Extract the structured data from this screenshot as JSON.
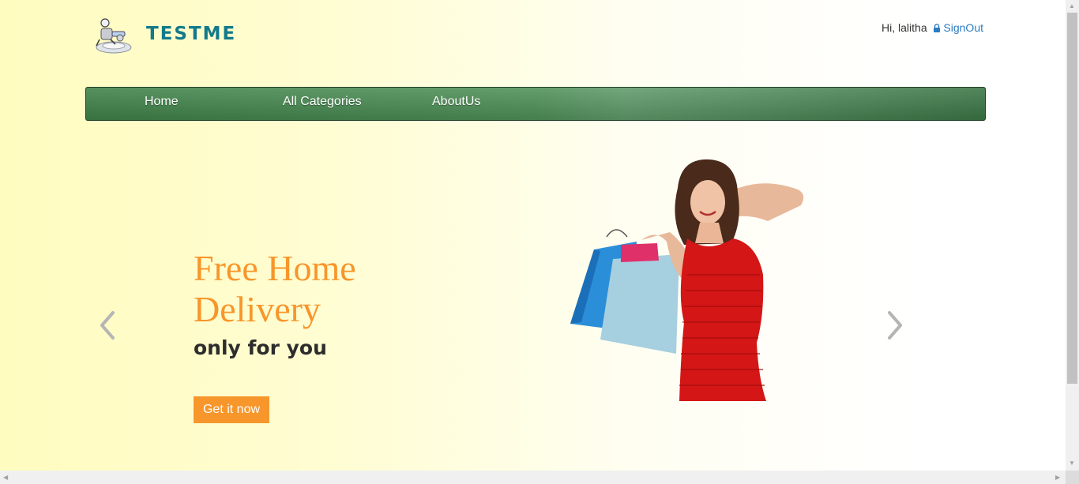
{
  "header": {
    "brand": "TESTME",
    "greeting": "Hi, lalitha",
    "signout_label": "SignOut",
    "icons": {
      "logo": "robot-mascot-logo",
      "lock": "lock-icon"
    }
  },
  "nav": {
    "items": [
      {
        "label": "Home"
      },
      {
        "label": "All Categories"
      },
      {
        "label": "AboutUs"
      }
    ]
  },
  "carousel": {
    "headline": "Free Home Delivery",
    "subline": "only for you",
    "cta_label": "Get it now",
    "image": "woman-in-red-dress-with-shopping-bags",
    "prev_icon": "chevron-left-icon",
    "next_icon": "chevron-right-icon"
  },
  "colors": {
    "brand": "#137a8b",
    "accent": "#f7962b",
    "nav": "#4f9058",
    "link": "#2a7bc0"
  }
}
